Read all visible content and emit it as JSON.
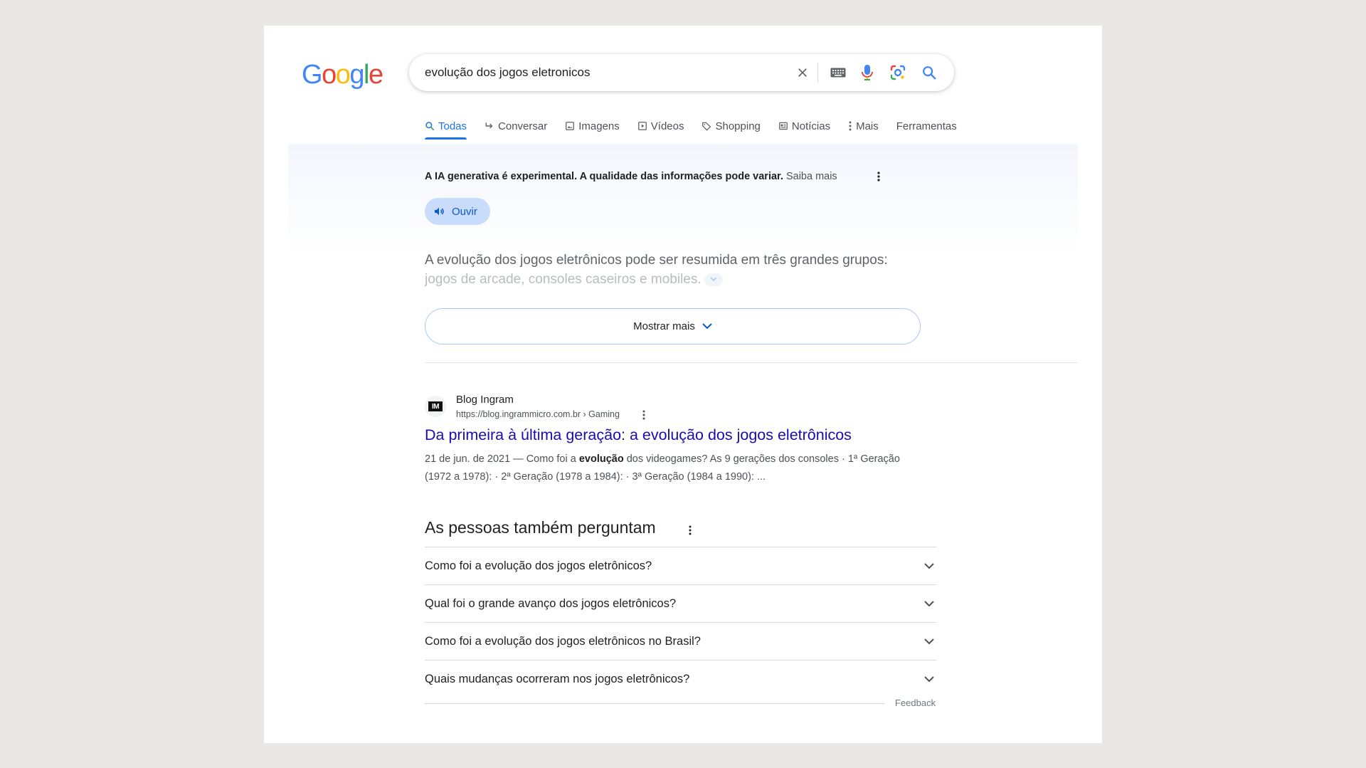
{
  "header": {
    "logo_letters": [
      {
        "char": "G",
        "color": "#4285f4"
      },
      {
        "char": "o",
        "color": "#ea4335"
      },
      {
        "char": "o",
        "color": "#fbbc05"
      },
      {
        "char": "g",
        "color": "#4285f4"
      },
      {
        "char": "l",
        "color": "#34a853"
      },
      {
        "char": "e",
        "color": "#ea4335"
      }
    ],
    "search_value": "evolução dos jogos eletronicos",
    "icons": [
      "close-icon",
      "keyboard-icon",
      "microphone-icon",
      "lens-icon",
      "search-icon"
    ]
  },
  "tabs": [
    {
      "label": "Todas",
      "icon": "search-icon",
      "active": true
    },
    {
      "label": "Conversar",
      "icon": "reply-arrow-icon",
      "active": false
    },
    {
      "label": "Imagens",
      "icon": "image-icon",
      "active": false
    },
    {
      "label": "Vídeos",
      "icon": "play-icon",
      "active": false
    },
    {
      "label": "Shopping",
      "icon": "tag-icon",
      "active": false
    },
    {
      "label": "Notícias",
      "icon": "newspaper-icon",
      "active": false
    },
    {
      "label": "Mais",
      "icon": "more-vert-icon",
      "active": false
    },
    {
      "label": "Ferramentas",
      "icon": "",
      "active": false
    }
  ],
  "ai_overview": {
    "notice": "A IA generativa é experimental. A qualidade das informações pode variar.",
    "notice_link": "Saiba mais",
    "listen_label": "Ouvir",
    "summary_line1": "A evolução dos jogos eletrônicos pode ser resumida em três grandes grupos:",
    "summary_line2": "jogos de arcade, consoles caseiros e mobiles.",
    "show_more_label": "Mostrar mais"
  },
  "result": {
    "site_name": "Blog Ingram",
    "favicon_text": "IM",
    "url": "https://blog.ingrammicro.com.br › Gaming",
    "title": "Da primeira à última geração: a evolução dos jogos eletrônicos",
    "snippet_date": "21 de jun. de 2021 —",
    "snippet_pre": " Como foi a ",
    "snippet_bold": "evolução",
    "snippet_post": " dos videogames? As 9 gerações dos consoles · 1ª Geração (1972 a 1978): · 2ª Geração (1978 a 1984): · 3ª Geração (1984 a 1990): ..."
  },
  "paa": {
    "title": "As pessoas também perguntam",
    "questions": [
      "Como foi a evolução dos jogos eletrônicos?",
      "Qual foi o grande avanço dos jogos eletrônicos?",
      "Como foi a evolução dos jogos eletrônicos no Brasil?",
      "Quais mudanças ocorreram nos jogos eletrônicos?"
    ],
    "feedback_label": "Feedback"
  },
  "colors": {
    "page_bg": "#e9e8e4",
    "link_blue": "#1a0dab",
    "accent_blue": "#1a73e8",
    "listen_bg": "#c9dcfb"
  }
}
